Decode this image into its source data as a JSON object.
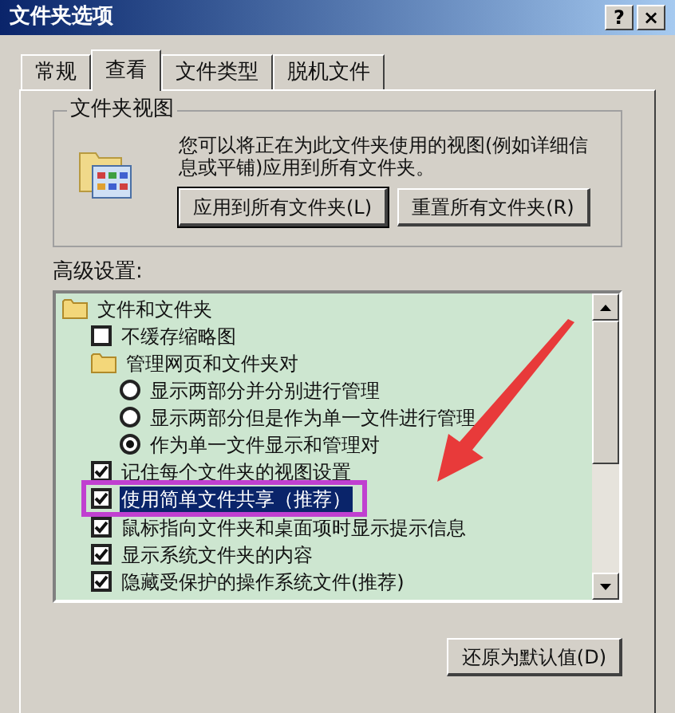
{
  "window": {
    "title": "文件夹选项",
    "buttons": [
      "?",
      "×"
    ]
  },
  "tabs": [
    {
      "label": "常规",
      "selected": false
    },
    {
      "label": "查看",
      "selected": true
    },
    {
      "label": "文件类型",
      "selected": false
    },
    {
      "label": "脱机文件",
      "selected": false
    }
  ],
  "folder_views": {
    "title": "文件夹视图",
    "description": "您可以将正在为此文件夹使用的视图(例如详细信息或平铺)应用到所有文件夹。",
    "buttons": [
      {
        "label": "应用到所有文件夹(L)",
        "focused": true
      },
      {
        "label": "重置所有文件夹(R)",
        "focused": false
      }
    ]
  },
  "advanced": {
    "label": "高级设置:",
    "items": [
      {
        "kind": "folder",
        "label": "文件和文件夹",
        "selected": false,
        "highlighted": false,
        "children": [
          {
            "kind": "checkbox",
            "label": "不缓存缩略图",
            "checked": false,
            "selected": false,
            "highlighted": false
          },
          {
            "kind": "folder",
            "label": "管理网页和文件夹对",
            "selected": false,
            "highlighted": false,
            "children": [
              {
                "kind": "radio",
                "label": "显示两部分并分别进行管理",
                "checked": false,
                "selected": false,
                "highlighted": false
              },
              {
                "kind": "radio",
                "label": "显示两部分但是作为单一文件进行管理",
                "checked": false,
                "selected": false,
                "highlighted": false
              },
              {
                "kind": "radio",
                "label": "作为单一文件显示和管理对",
                "checked": true,
                "selected": false,
                "highlighted": false
              }
            ]
          },
          {
            "kind": "checkbox",
            "label": "记住每个文件夹的视图设置",
            "checked": true,
            "selected": false,
            "highlighted": false
          },
          {
            "kind": "checkbox",
            "label": "使用简单文件共享（推荐）",
            "checked": true,
            "selected": true,
            "highlighted": true
          },
          {
            "kind": "checkbox",
            "label": "鼠标指向文件夹和桌面项时显示提示信息",
            "checked": true,
            "selected": false,
            "highlighted": false
          },
          {
            "kind": "checkbox",
            "label": "显示系统文件夹的内容",
            "checked": true,
            "selected": false,
            "highlighted": false
          },
          {
            "kind": "checkbox",
            "label": "隐藏受保护的操作系统文件(推荐)",
            "checked": true,
            "selected": false,
            "highlighted": false
          }
        ]
      }
    ]
  },
  "restore_button": "还原为默认值(D)"
}
